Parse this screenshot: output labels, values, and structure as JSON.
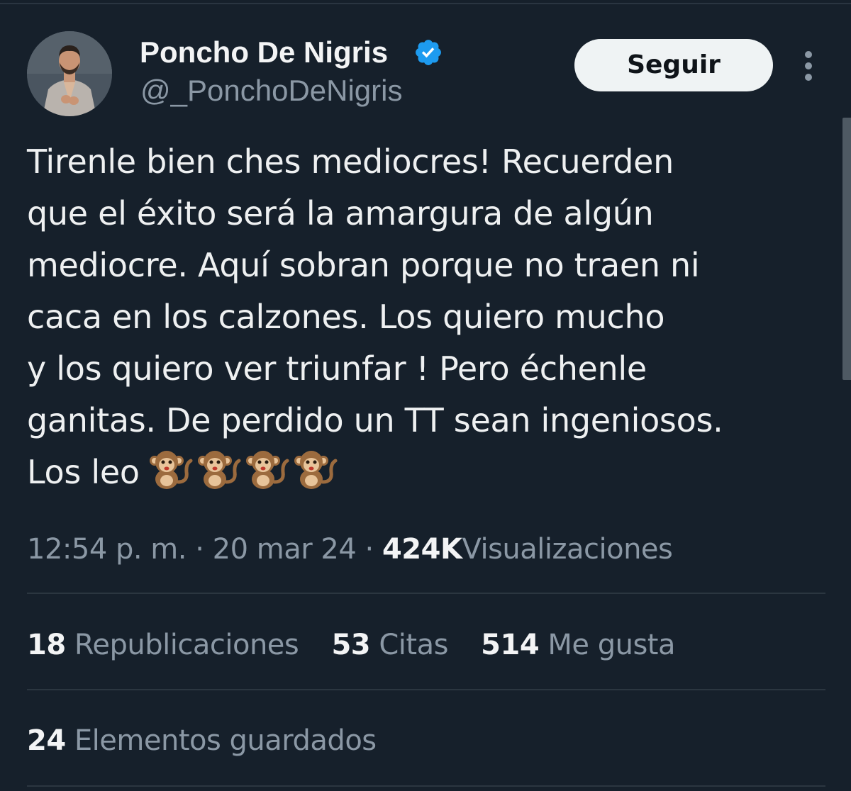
{
  "author": {
    "display_name": "Poncho De Nigris",
    "handle": "@_PonchoDeNigris",
    "verified": true
  },
  "follow_button": {
    "label": "Seguir"
  },
  "tweet": {
    "lines": [
      "Tirenle bien ches mediocres! Recuerden",
      "que el éxito será la amargura de algún",
      "mediocre. Aquí sobran porque no traen ni",
      "caca en los calzones. Los quiero mucho",
      "y los quiero ver triunfar ! Pero échenle",
      "ganitas. De perdido un TT sean ingeniosos.",
      "Los leo"
    ],
    "emojis": [
      "monkey-emoji",
      "monkey-emoji",
      "monkey-emoji",
      "monkey-emoji"
    ]
  },
  "meta": {
    "time": "12:54 p. m.",
    "separator": "·",
    "date": "20 mar 24",
    "views_count": "424K",
    "views_label": "Visualizaciones"
  },
  "stats": {
    "reposts_count": "18",
    "reposts_label": "Republicaciones",
    "quotes_count": "53",
    "quotes_label": "Citas",
    "likes_count": "514",
    "likes_label": "Me gusta"
  },
  "saves": {
    "count": "24",
    "label": "Elementos guardados"
  },
  "colors": {
    "background": "#16202b",
    "text_primary": "#e7e9ea",
    "text_secondary": "#8b98a5",
    "verified_blue": "#1d9bf0",
    "divider": "#2b3640",
    "button_bg": "#eff3f4"
  }
}
